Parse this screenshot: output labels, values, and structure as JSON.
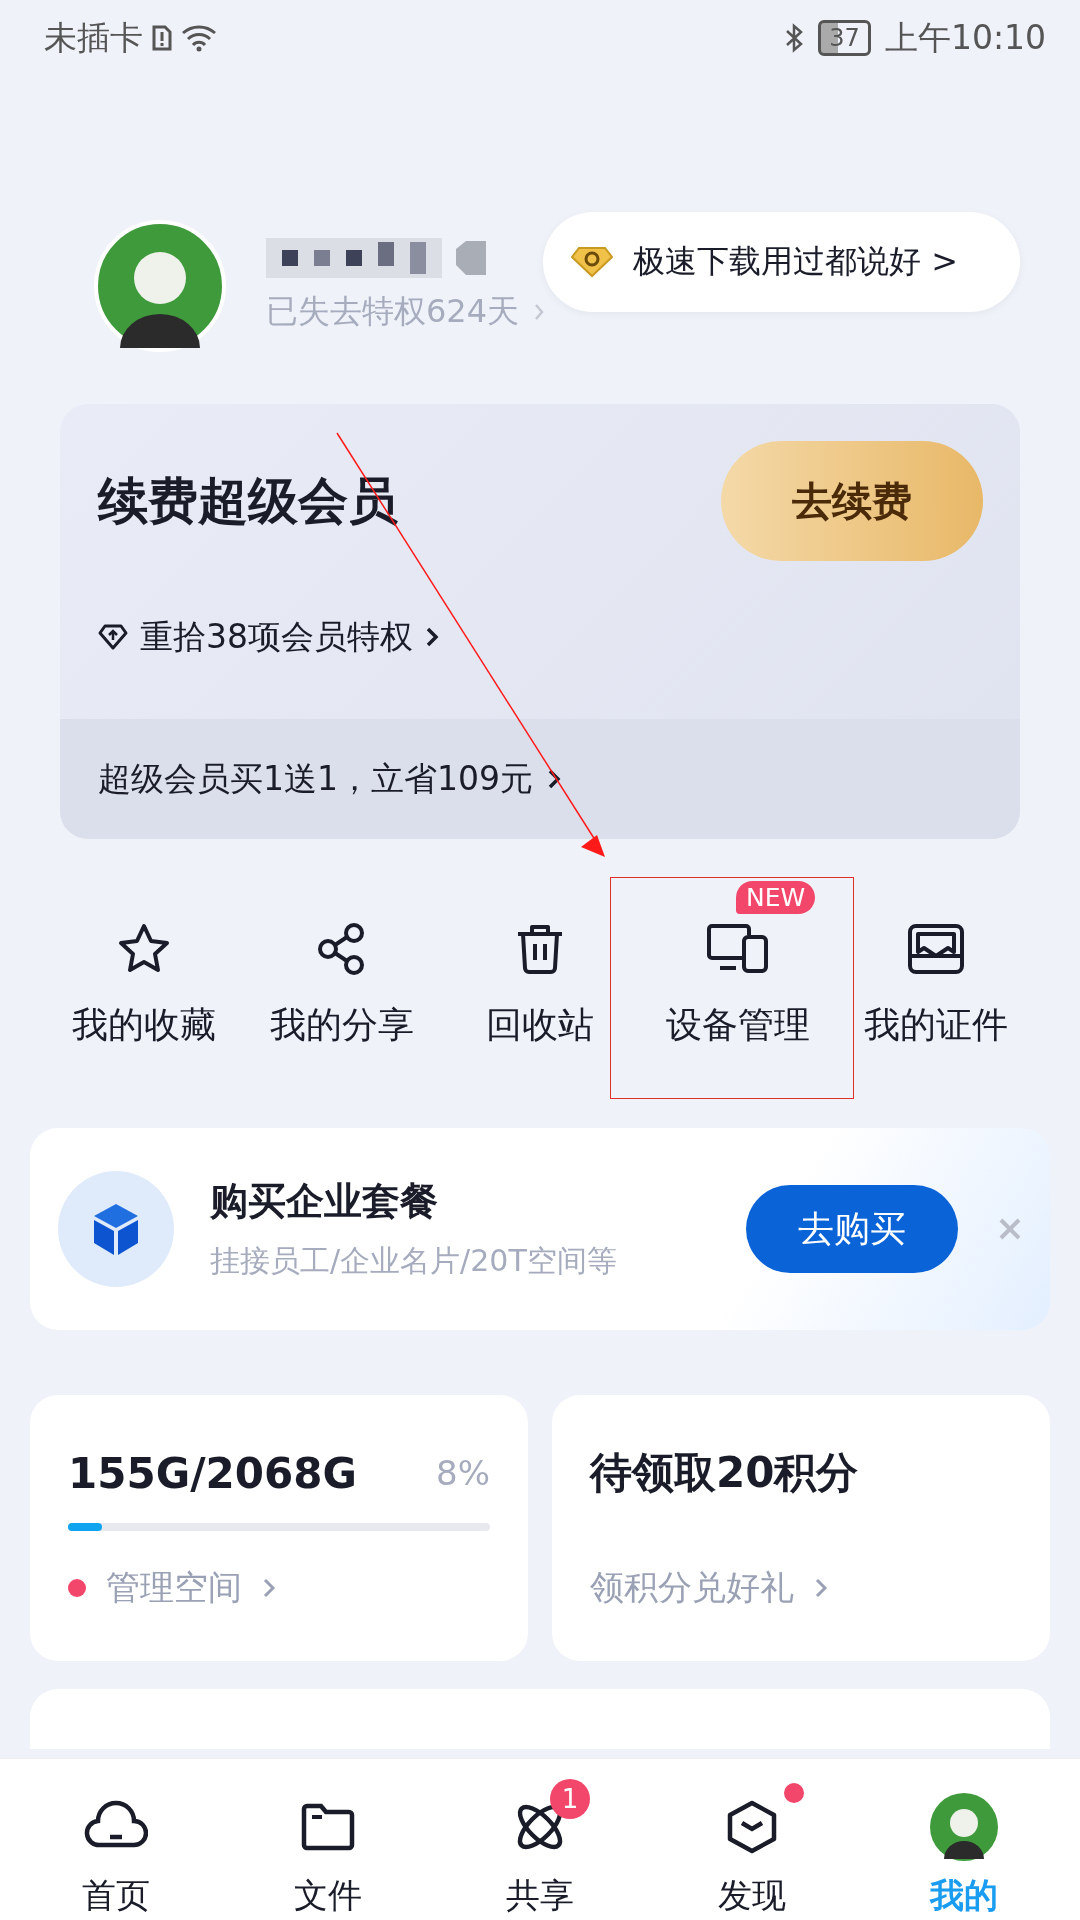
{
  "status_bar": {
    "carrier": "未插卡",
    "battery": "37",
    "time": "上午10:10"
  },
  "profile": {
    "privilege_note": "已失去特权624天",
    "tooltip": "极速下载用过都说好 >"
  },
  "vip_card": {
    "title": "续费超级会员",
    "button": "去续费",
    "perks": "重拾38项会员特权",
    "promo": "超级会员买1送1，立省109元"
  },
  "shortcuts": [
    {
      "kind": "star",
      "label": "我的收藏"
    },
    {
      "kind": "share",
      "label": "我的分享"
    },
    {
      "kind": "trash",
      "label": "回收站"
    },
    {
      "kind": "devices",
      "label": "设备管理",
      "badge": "NEW"
    },
    {
      "kind": "id",
      "label": "我的证件"
    }
  ],
  "enterprise": {
    "title": "购买企业套餐",
    "subtitle": "挂接员工/企业名片/20T空间等",
    "button": "去购买"
  },
  "storage": {
    "usage": "155G/2068G",
    "percent": "8%",
    "level": 0.08,
    "link": "管理空间"
  },
  "points": {
    "title": "待领取20积分",
    "link": "领积分兑好礼"
  },
  "nav": [
    {
      "kind": "cloud",
      "label": "首页",
      "selected": false
    },
    {
      "kind": "folder",
      "label": "文件",
      "selected": false
    },
    {
      "kind": "atom",
      "label": "共享",
      "selected": false,
      "badge": "1"
    },
    {
      "kind": "cube",
      "label": "发现",
      "selected": false,
      "dot": true
    },
    {
      "kind": "avatar",
      "label": "我的",
      "selected": true
    }
  ]
}
